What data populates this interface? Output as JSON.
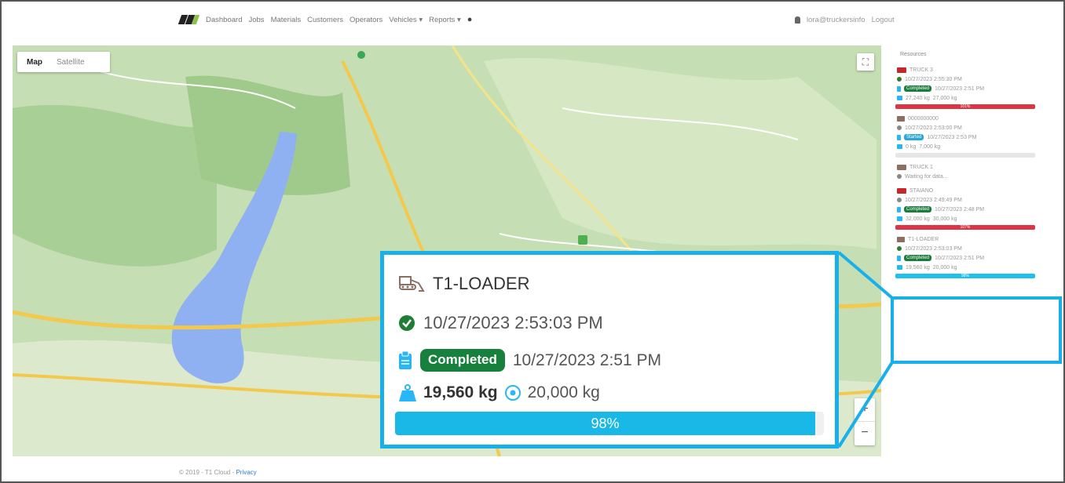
{
  "nav": {
    "items": [
      "Dashboard",
      "Jobs",
      "Materials",
      "Customers",
      "Operators",
      "Vehicles ▾",
      "Reports ▾"
    ],
    "user": "lora@truckersinfo",
    "logout": "Logout"
  },
  "map": {
    "map_label": "Map",
    "satellite_label": "Satellite",
    "zoom_in": "+",
    "zoom_out": "−"
  },
  "sidebar": {
    "title": "Resources",
    "units": [
      {
        "name": "TRUCK 3",
        "time": "10/27/2023 2:55:30 PM",
        "status": "Completed",
        "status_time": "10/27/2023 2:51 PM",
        "weight": "27,240 kg",
        "capacity": "27,000 kg",
        "progress_label": "101%"
      },
      {
        "name": "0000000000",
        "time": "10/27/2023 2:53:00 PM",
        "status": "Started",
        "status_time": "10/27/2023 2:53 PM",
        "weight": "0 kg",
        "capacity": "7,000 kg",
        "progress_label": ""
      },
      {
        "name": "TRUCK 1",
        "time": "Waiting for data..."
      },
      {
        "name": "STAIANO",
        "time": "10/27/2023 2:49:49 PM",
        "status": "Completed",
        "status_time": "10/27/2023 2:48 PM",
        "weight": "32,000 kg",
        "capacity": "30,000 kg",
        "progress_label": "107%"
      },
      {
        "name": "T1-LOADER",
        "time": "10/27/2023 2:53:03 PM",
        "status": "Completed",
        "status_time": "10/27/2023 2:51 PM",
        "weight": "19,560 kg",
        "capacity": "20,000 kg",
        "progress_label": "98%"
      }
    ]
  },
  "callout": {
    "name": "T1-LOADER",
    "timestamp": "10/27/2023 2:53:03 PM",
    "status": "Completed",
    "status_time": "10/27/2023 2:51 PM",
    "weight": "19,560 kg",
    "capacity": "20,000 kg",
    "progress": 0.98,
    "progress_label": "98%"
  },
  "footer": {
    "copyright": "© 2019 - T1 Cloud - ",
    "privacy": "Privacy"
  },
  "colors": {
    "accent": "#18b0ea",
    "completed": "#17803d",
    "danger": "#dc3545"
  }
}
